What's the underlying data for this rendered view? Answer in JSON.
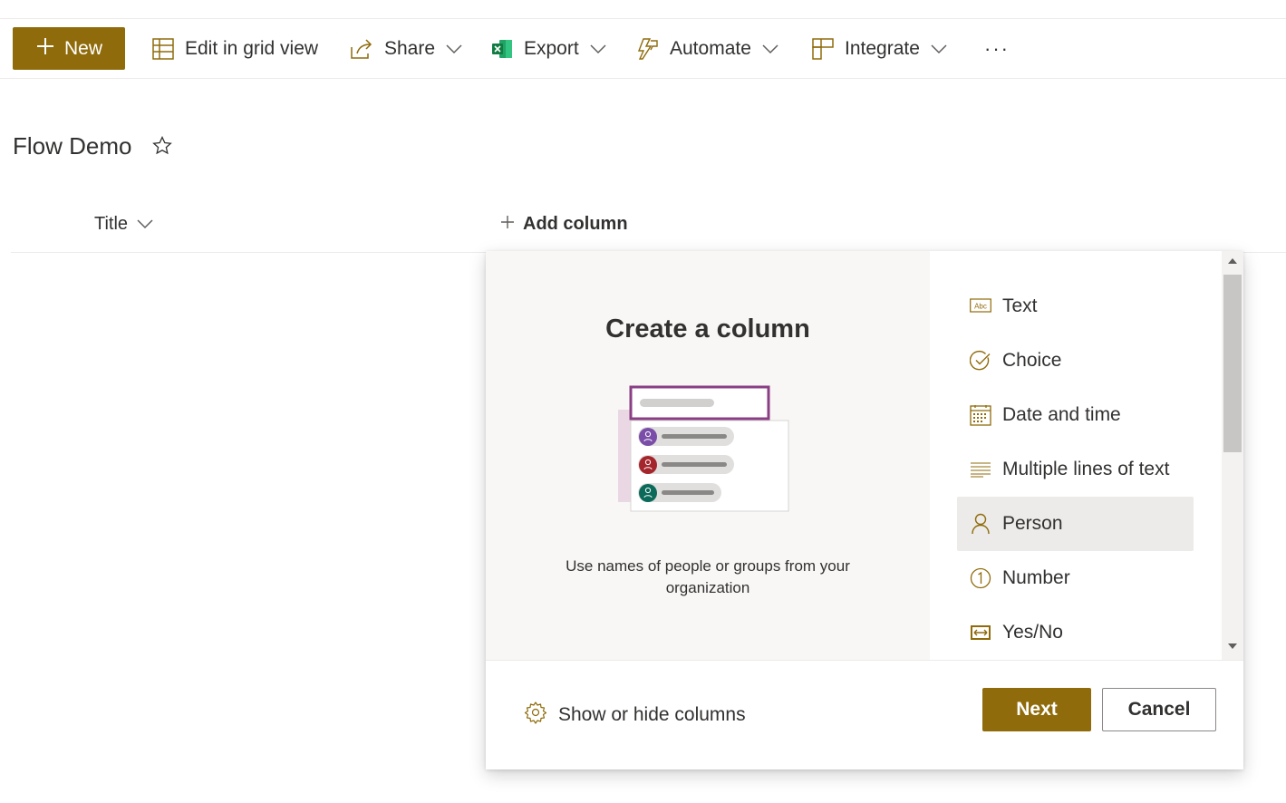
{
  "toolbar": {
    "new_label": "New",
    "edit_grid_label": "Edit in grid view",
    "share_label": "Share",
    "export_label": "Export",
    "automate_label": "Automate",
    "integrate_label": "Integrate",
    "more_label": "···"
  },
  "list": {
    "title": "Flow Demo",
    "columns": {
      "title_label": "Title",
      "add_column_label": "Add column"
    }
  },
  "panel": {
    "heading": "Create a column",
    "description": "Use names of people or groups from your organization",
    "types": [
      {
        "label": "Text",
        "icon": "text-abc-icon"
      },
      {
        "label": "Choice",
        "icon": "choice-check-icon"
      },
      {
        "label": "Date and time",
        "icon": "calendar-icon"
      },
      {
        "label": "Multiple lines of text",
        "icon": "multiline-text-icon"
      },
      {
        "label": "Person",
        "icon": "person-icon",
        "selected": true
      },
      {
        "label": "Number",
        "icon": "number-icon"
      },
      {
        "label": "Yes/No",
        "icon": "yes-no-icon"
      }
    ],
    "show_hide_label": "Show or hide columns",
    "next_label": "Next",
    "cancel_label": "Cancel"
  },
  "colors": {
    "accent": "#8f6b0b",
    "icon_gold": "#8f6b0b",
    "selected_bg": "#edebe9"
  }
}
